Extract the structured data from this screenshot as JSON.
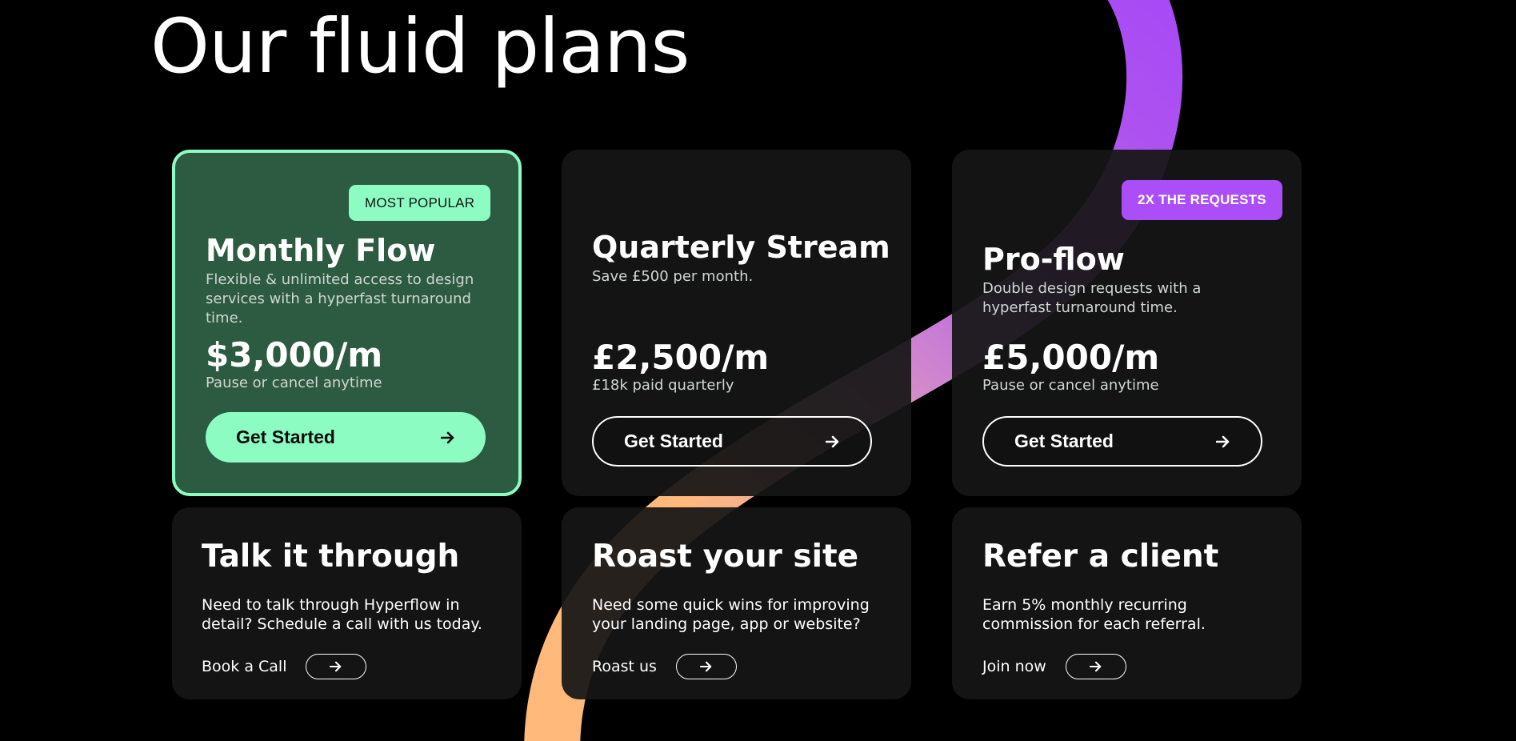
{
  "heading": "Our fluid plans",
  "colors": {
    "background": "#000000",
    "card": "#161616",
    "featured_card": "#2d5b41",
    "mint_accent": "#8cfcc3",
    "purple_accent": "#ac4ef7",
    "orange_ribbon": "#ffb97a"
  },
  "plans": [
    {
      "badge": "MOST POPULAR",
      "name": "Monthly Flow",
      "description": "Flexible & unlimited access to design services with a hyperfast turnaround time.",
      "price": "$3,000/m",
      "price_note": "Pause or cancel anytime",
      "cta_label": "Get Started",
      "cta_icon": "arrow-right-icon"
    },
    {
      "name": "Quarterly Stream",
      "description": "Save £500 per month.",
      "price": "£2,500/m",
      "price_note": "£18k paid quarterly",
      "cta_label": "Get Started",
      "cta_icon": "arrow-right-icon"
    },
    {
      "badge": "2X THE REQUESTS",
      "name": "Pro-flow",
      "description": "Double design requests with a hyperfast turnaround time.",
      "price": "£5,000/m",
      "price_note": "Pause or cancel anytime",
      "cta_label": "Get Started",
      "cta_icon": "arrow-right-icon"
    }
  ],
  "extras": [
    {
      "title": "Talk it through",
      "description": "Need to talk through Hyperflow in detail? Schedule a call with us today.",
      "link_label": "Book a Call",
      "link_icon": "arrow-right-icon"
    },
    {
      "title": "Roast your site",
      "description": "Need some quick wins for improving your landing page, app or website?",
      "link_label": "Roast us",
      "link_icon": "arrow-right-icon"
    },
    {
      "title": "Refer a client",
      "description": "Earn 5% monthly recurring commission for each referral.",
      "link_label": "Join now",
      "link_icon": "arrow-right-icon"
    }
  ]
}
